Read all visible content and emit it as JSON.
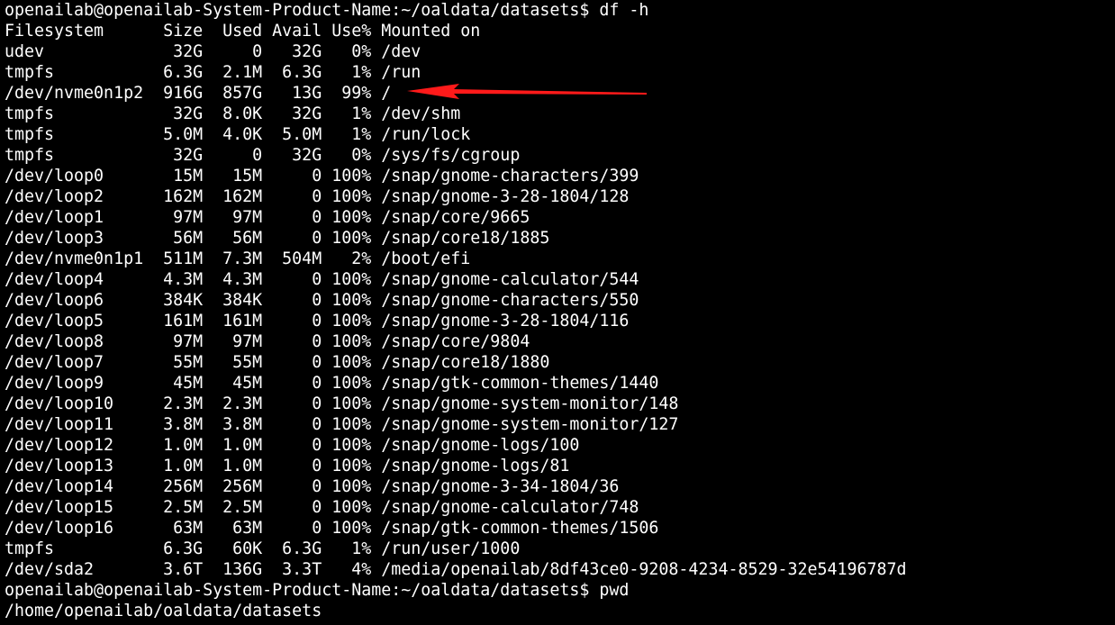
{
  "colors": {
    "background": "#000000",
    "text": "#ffffff",
    "arrow": "#ff1a1a",
    "cursor": "#00ff00"
  },
  "terminal": {
    "lines": [
      "openailab@openailab-System-Product-Name:~/oaldata/datasets$ df -h",
      "Filesystem      Size  Used Avail Use% Mounted on",
      "udev             32G     0   32G   0% /dev",
      "tmpfs           6.3G  2.1M  6.3G   1% /run",
      "/dev/nvme0n1p2  916G  857G   13G  99% /",
      "tmpfs            32G  8.0K   32G   1% /dev/shm",
      "tmpfs           5.0M  4.0K  5.0M   1% /run/lock",
      "tmpfs            32G     0   32G   0% /sys/fs/cgroup",
      "/dev/loop0       15M   15M     0 100% /snap/gnome-characters/399",
      "/dev/loop2      162M  162M     0 100% /snap/gnome-3-28-1804/128",
      "/dev/loop1       97M   97M     0 100% /snap/core/9665",
      "/dev/loop3       56M   56M     0 100% /snap/core18/1885",
      "/dev/nvme0n1p1  511M  7.3M  504M   2% /boot/efi",
      "/dev/loop4      4.3M  4.3M     0 100% /snap/gnome-calculator/544",
      "/dev/loop6      384K  384K     0 100% /snap/gnome-characters/550",
      "/dev/loop5      161M  161M     0 100% /snap/gnome-3-28-1804/116",
      "/dev/loop8       97M   97M     0 100% /snap/core/9804",
      "/dev/loop7       55M   55M     0 100% /snap/core18/1880",
      "/dev/loop9       45M   45M     0 100% /snap/gtk-common-themes/1440",
      "/dev/loop10     2.3M  2.3M     0 100% /snap/gnome-system-monitor/148",
      "/dev/loop11     3.8M  3.8M     0 100% /snap/gnome-system-monitor/127",
      "/dev/loop12     1.0M  1.0M     0 100% /snap/gnome-logs/100",
      "/dev/loop13     1.0M  1.0M     0 100% /snap/gnome-logs/81",
      "/dev/loop14     256M  256M     0 100% /snap/gnome-3-34-1804/36",
      "/dev/loop15     2.5M  2.5M     0 100% /snap/gnome-calculator/748",
      "/dev/loop16      63M   63M     0 100% /snap/gtk-common-themes/1506",
      "tmpfs           6.3G   60K  6.3G   1% /run/user/1000",
      "/dev/sda2       3.6T  136G  3.3T   4% /media/openailab/8df43ce0-9208-4234-8529-32e54196787d",
      "openailab@openailab-System-Product-Name:~/oaldata/datasets$ pwd",
      "/home/openailab/oaldata/datasets"
    ]
  },
  "annotation": {
    "icon": "red-arrow-left-icon"
  }
}
